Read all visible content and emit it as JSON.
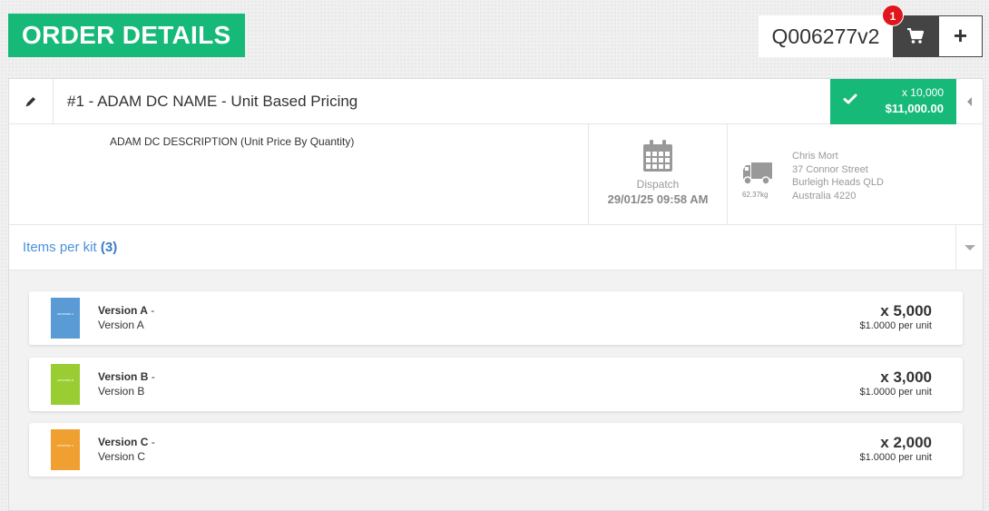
{
  "header": {
    "title": "ORDER DETAILS",
    "quote_ref": "Q006277v2",
    "cart_count": "1",
    "add_label": "+"
  },
  "line_item": {
    "title": "#1 - ADAM DC NAME - Unit Based Pricing",
    "quantity": "x 10,000",
    "price": "$11,000.00",
    "description": "ADAM DC DESCRIPTION (Unit Price By Quantity)",
    "dispatch_label": "Dispatch",
    "dispatch_date": "29/01/25 09:58 AM",
    "weight": "62.37kg",
    "address": [
      "Chris Mort",
      "37 Connor Street",
      "Burleigh Heads QLD",
      "Australia 4220"
    ]
  },
  "kit": {
    "label": "Items per kit",
    "count": "(3)"
  },
  "items": [
    {
      "name": "Version A",
      "suffix": " -",
      "sub": "Version A",
      "qty": "x 5,000",
      "unit_price": "$1.0000 per unit",
      "color": "#5b9bd5",
      "thumb_text": "ARTWORK A"
    },
    {
      "name": "Version B",
      "suffix": " -",
      "sub": "Version B",
      "qty": "x 3,000",
      "unit_price": "$1.0000 per unit",
      "color": "#9acd32",
      "thumb_text": "ARTWORK B"
    },
    {
      "name": "Version C",
      "suffix": " -",
      "sub": "Version C",
      "qty": "x 2,000",
      "unit_price": "$1.0000 per unit",
      "color": "#f0a030",
      "thumb_text": "ARTWORK C"
    }
  ],
  "colors": {
    "accent": "#17b978",
    "badge": "#e1161d",
    "link": "#4a90d9"
  }
}
